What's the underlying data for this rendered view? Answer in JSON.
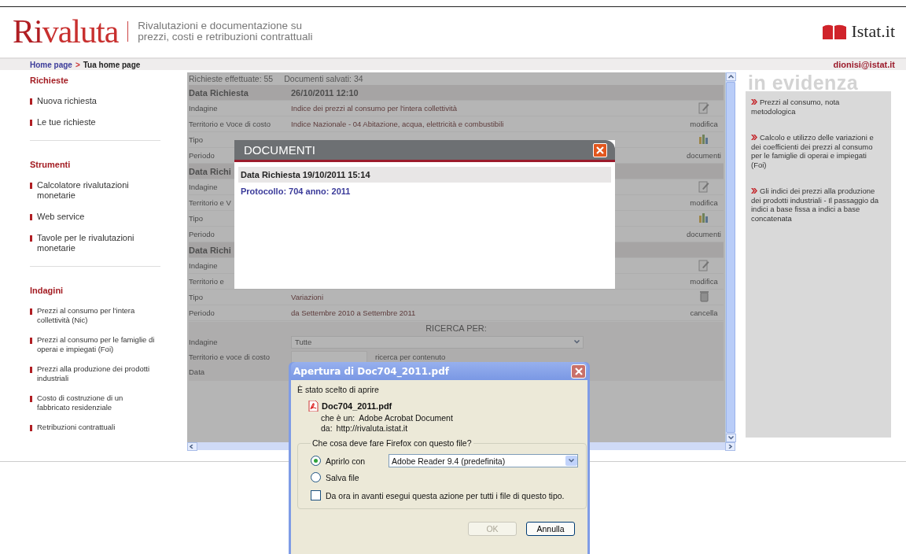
{
  "header": {
    "logo_accent": "Ri",
    "logo_rest": "valuta",
    "tagline": [
      "Rivalutazioni e documentazione su",
      "prezzi, costi e retribuzioni contrattuali"
    ],
    "partner": "Istat.it"
  },
  "breadcrumb": {
    "items": [
      {
        "label": "Home page",
        "kind": "link"
      },
      {
        "label": ">",
        "kind": "sep"
      },
      {
        "label": "Tua home page",
        "kind": "current"
      }
    ],
    "user": "dionisi@istat.it"
  },
  "sidebar": {
    "sections": [
      {
        "title": "Richieste",
        "kind": "large",
        "items": [
          "Nuova richiesta",
          "Le tue richieste"
        ]
      },
      {
        "title": "Strumenti",
        "kind": "large",
        "items": [
          "Calcolatore rivalutazioni monetarie",
          "Web service",
          "Tavole per le rivalutazioni monetarie"
        ]
      },
      {
        "title": "Indagini",
        "kind": "small",
        "items": [
          "Prezzi al consumo per l'intera collettività (Nic)",
          "Prezzi al consumo per le famiglie di operai e impiegati (Foi)",
          "Prezzi alla produzione dei prodotti industriali",
          "Costo di costruzione di un fabbricato residenziale",
          "Retribuzioni contrattuali"
        ]
      }
    ]
  },
  "content": {
    "summary": [
      "Richieste effettuate: 55",
      "Documenti salvati: 34"
    ],
    "rows": [
      {
        "kind": "head",
        "label": "Data Richiesta",
        "value": "26/10/2011 12:10"
      },
      {
        "kind": "field",
        "label": "Indagine",
        "value": "Indice dei prezzi al consumo per l'intera collettività",
        "tool": {
          "kind": "edit"
        }
      },
      {
        "kind": "field",
        "label": "Territorio e Voce di costo",
        "value": "Indice Nazionale - 04 Abitazione, acqua, elettricità e combustibili",
        "action": "modifica"
      },
      {
        "kind": "field",
        "label": "Tipo",
        "tool": {
          "kind": "docs"
        }
      },
      {
        "kind": "field",
        "label": "Periodo",
        "action": "documenti"
      },
      {
        "kind": "head",
        "label": "Data Richi"
      },
      {
        "kind": "field",
        "label": "Indagine",
        "tool": {
          "kind": "edit"
        }
      },
      {
        "kind": "field",
        "label": "Territorio e V",
        "action": "modifica"
      },
      {
        "kind": "field",
        "label": "Tipo",
        "tool": {
          "kind": "docs"
        }
      },
      {
        "kind": "field",
        "label": "Periodo",
        "action": "documenti"
      },
      {
        "kind": "head",
        "label": "Data Richi"
      },
      {
        "kind": "field",
        "label": "Indagine",
        "tool": {
          "kind": "edit"
        }
      },
      {
        "kind": "field",
        "label": "Territorio e",
        "action": "modifica"
      },
      {
        "kind": "field",
        "label": "Tipo",
        "value": "Variazioni",
        "tool": {
          "kind": "delete"
        }
      },
      {
        "kind": "field",
        "label": "Periodo",
        "value": "da Settembre 2010 a Settembre 2011",
        "action": "cancella"
      }
    ],
    "search": {
      "title": "RICERCA PER:",
      "fields": [
        {
          "label": "Indagine",
          "kind": "select",
          "value": "Tutte"
        },
        {
          "label": "Territorio e voce di costo",
          "kind": "input",
          "link": "ricerca per contenuto"
        },
        {
          "label": "Data",
          "kind": "text"
        }
      ]
    }
  },
  "documents_modal": {
    "title": "DOCUMENTI",
    "request": "Data Richiesta 19/10/2011 15:14",
    "protocol": "Protocollo: 704 anno: 2011"
  },
  "download_dialog": {
    "title": "Apertura di Doc704_2011.pdf",
    "intro": "È stato scelto di aprire",
    "file": "Doc704_2011.pdf",
    "type_label": "che è un:",
    "type": "Adobe Acrobat Document",
    "from_label": "da:",
    "from": "http://rivaluta.istat.it",
    "question": "Che cosa deve fare Firefox con questo file?",
    "options": [
      {
        "label": "Aprirlo con",
        "selected": true,
        "app": "Adobe Reader 9.4 (predefinita)"
      },
      {
        "label": "Salva file",
        "selected": false
      }
    ],
    "remember": {
      "label": "Da ora in avanti esegui questa azione per tutti i file di questo tipo.",
      "checked": false
    },
    "buttons": [
      {
        "label": "OK",
        "disabled": true
      },
      {
        "label": "Annulla",
        "disabled": false
      }
    ]
  },
  "highlights": {
    "title": "in evidenza",
    "items": [
      "Prezzi al consumo, nota metodologica",
      "Calcolo e utilizzo delle variazioni e dei coefficienti dei prezzi al consumo per le famiglie di operai e impiegati (Foi)",
      "Gli indici dei prezzi alla produzione dei prodotti industriali - Il passaggio da indici a base fissa a indici a base concatenata"
    ]
  }
}
